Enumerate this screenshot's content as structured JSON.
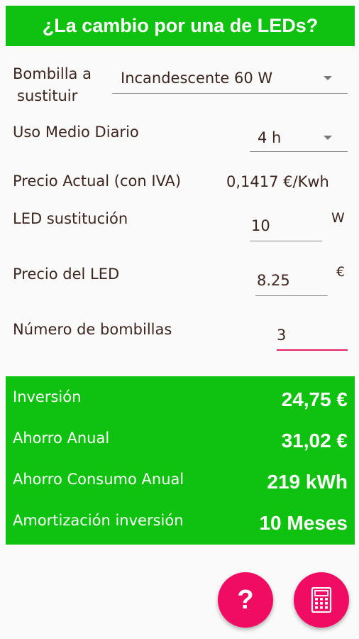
{
  "header": {
    "title": "¿La cambio por una de LEDs?"
  },
  "form": {
    "bulb_label_line1": "Bombilla a",
    "bulb_label_line2": "sustituir",
    "bulb_value": "Incandescente 60 W",
    "usage_label": "Uso Medio Diario",
    "usage_value": "4 h",
    "price_label": "Precio Actual (con IVA)",
    "price_value": "0,1417 €/Kwh",
    "led_label": "LED sustitución",
    "led_value": "10",
    "led_unit": "W",
    "led_price_label": "Precio del LED",
    "led_price_value": "8.25",
    "led_price_unit": "€",
    "count_label": "Número de bombillas",
    "count_value": "3"
  },
  "results": {
    "investment_label": "Inversión",
    "investment_value": "24,75 €",
    "annual_savings_label": "Ahorro Anual",
    "annual_savings_value": "31,02 €",
    "annual_consumption_label": "Ahorro Consumo Anual",
    "annual_consumption_value": "219 kWh",
    "payback_label": "Amortización inversión",
    "payback_value": "10 Meses"
  },
  "fabs": {
    "help_icon": "question-mark-icon",
    "help_glyph": "?",
    "calc_icon": "calculator-icon"
  },
  "colors": {
    "accent_green": "#0fc20f",
    "accent_pink": "#f10c63",
    "text": "#3e2620"
  }
}
